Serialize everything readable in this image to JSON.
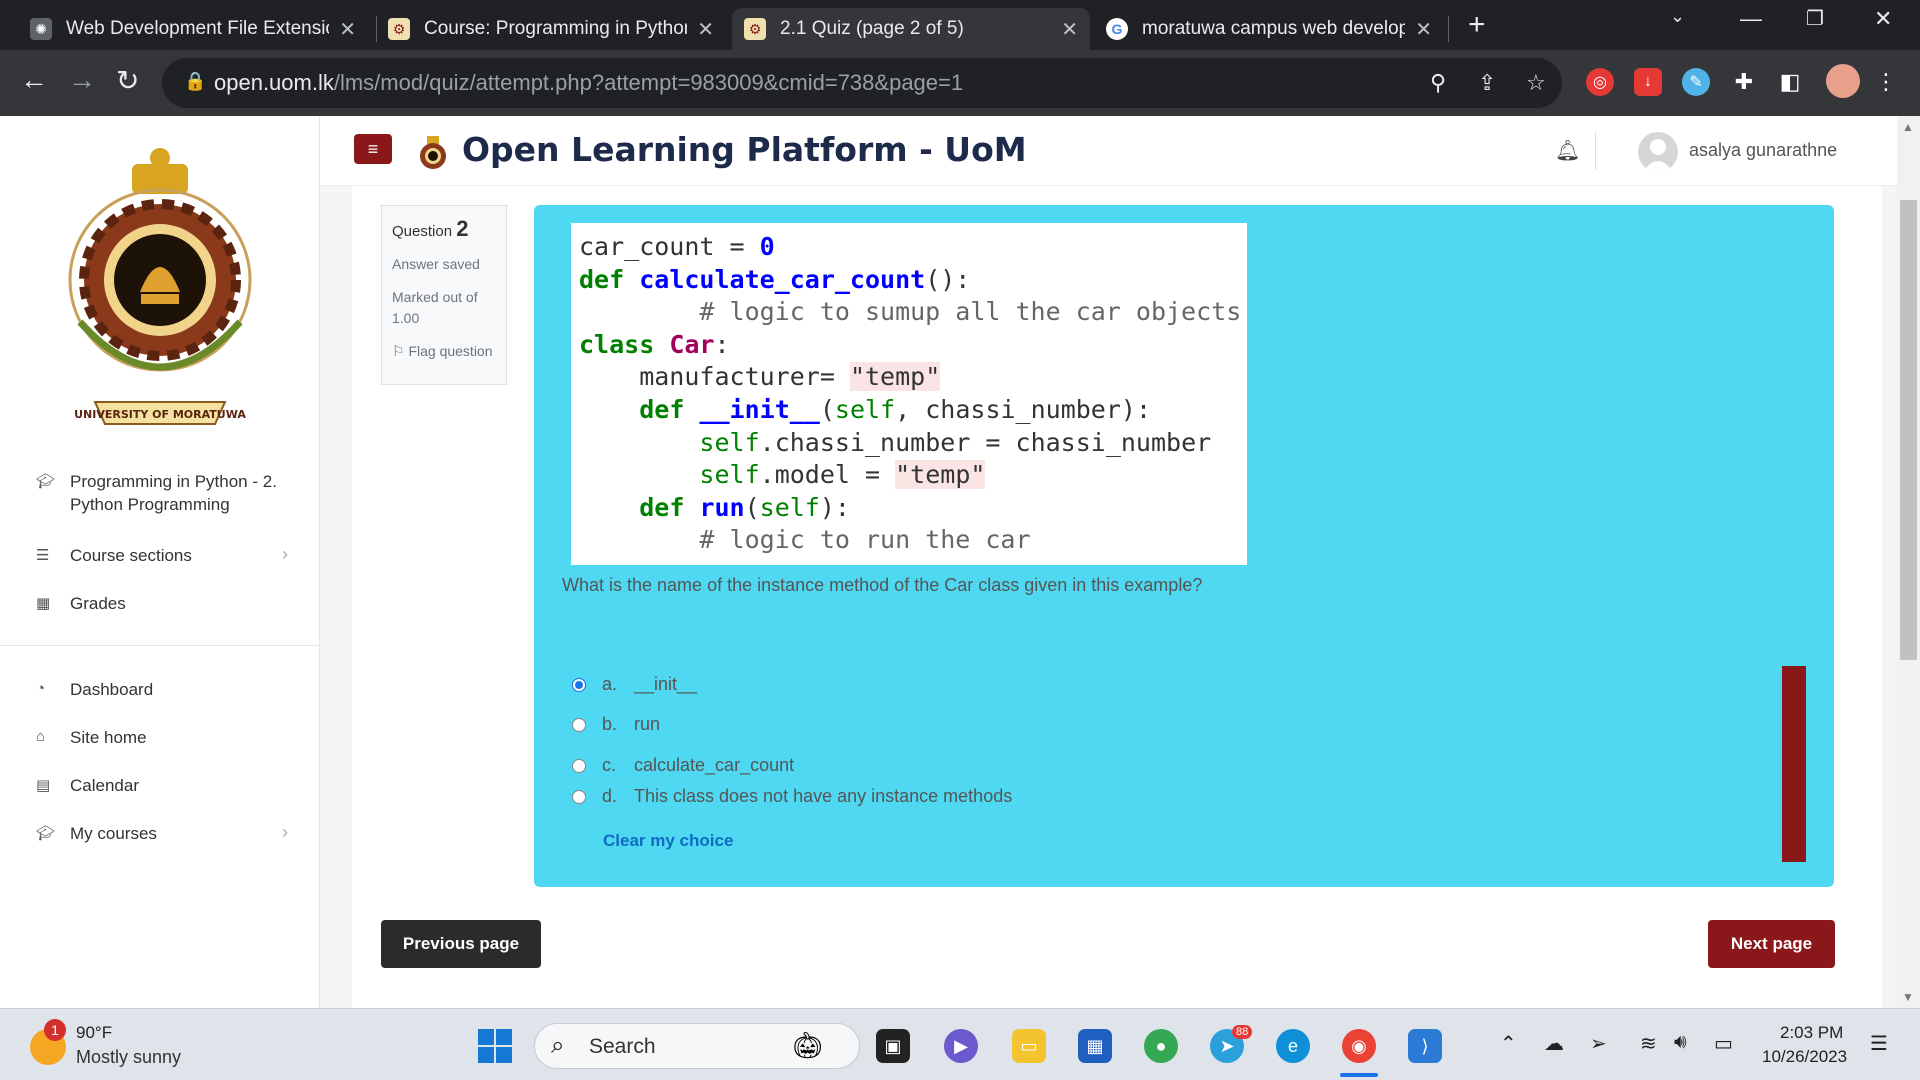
{
  "browser": {
    "tabs": [
      {
        "title": "Web Development File Extension",
        "favicon": "chatgpt-icon"
      },
      {
        "title": "Course: Programming in Python",
        "favicon": "uom-crest-icon"
      },
      {
        "title": "2.1 Quiz (page 2 of 5)",
        "favicon": "uom-crest-icon",
        "active": true
      },
      {
        "title": "moratuwa campus web develop",
        "favicon": "google-icon"
      }
    ],
    "url_host": "open.uom.lk",
    "url_path": "/lms/mod/quiz/attempt.php?attempt=983009&cmid=738&page=1"
  },
  "site": {
    "title": "Open Learning Platform - UoM",
    "username": "asalya gunarathne",
    "logo_text": "UNIVERSITY OF MORATUWA",
    "accent": "#8a1719"
  },
  "sidebar": {
    "course": "Programming in Python - 2. Python Programming",
    "items": [
      {
        "label": "Course sections",
        "icon": "list-icon",
        "chevron": true
      },
      {
        "label": "Grades",
        "icon": "table-icon",
        "chevron": false
      },
      {
        "label": "Dashboard",
        "icon": "dashboard-icon",
        "chevron": false
      },
      {
        "label": "Site home",
        "icon": "home-icon",
        "chevron": false
      },
      {
        "label": "Calendar",
        "icon": "calendar-icon",
        "chevron": false
      },
      {
        "label": "My courses",
        "icon": "graduation-cap-icon",
        "chevron": true
      }
    ]
  },
  "question": {
    "label": "Question",
    "number": "2",
    "state": "Answer saved",
    "marks": "Marked out of 1.00",
    "flag": "Flag question",
    "text": "What is the name of the instance method of the Car class given in this example?",
    "options": [
      {
        "letter": "a.",
        "text": "__init__",
        "selected": true
      },
      {
        "letter": "b.",
        "text": "run",
        "selected": false
      },
      {
        "letter": "c.",
        "text": "calculate_car_count",
        "selected": false
      },
      {
        "letter": "d.",
        "text": "This class does not have any instance methods",
        "selected": false
      }
    ],
    "clear": "Clear my choice"
  },
  "code": [
    "car_count = 0",
    "def calculate_car_count():",
    "        # logic to sumup all the car objects",
    "class Car:",
    "    manufacturer= \"temp\"",
    "    def __init__(self, chassi_number):",
    "        self.chassi_number = chassi_number",
    "        self.model = \"temp\"",
    "    def run(self):",
    "        # logic to run the car"
  ],
  "navigation": {
    "prev": "Previous page",
    "next": "Next page"
  },
  "taskbar": {
    "temperature": "90°F",
    "condition": "Mostly sunny",
    "weather_badge": "1",
    "search_placeholder": "Search",
    "time": "2:03 PM",
    "date": "10/26/2023",
    "telegram_badge": "88"
  }
}
